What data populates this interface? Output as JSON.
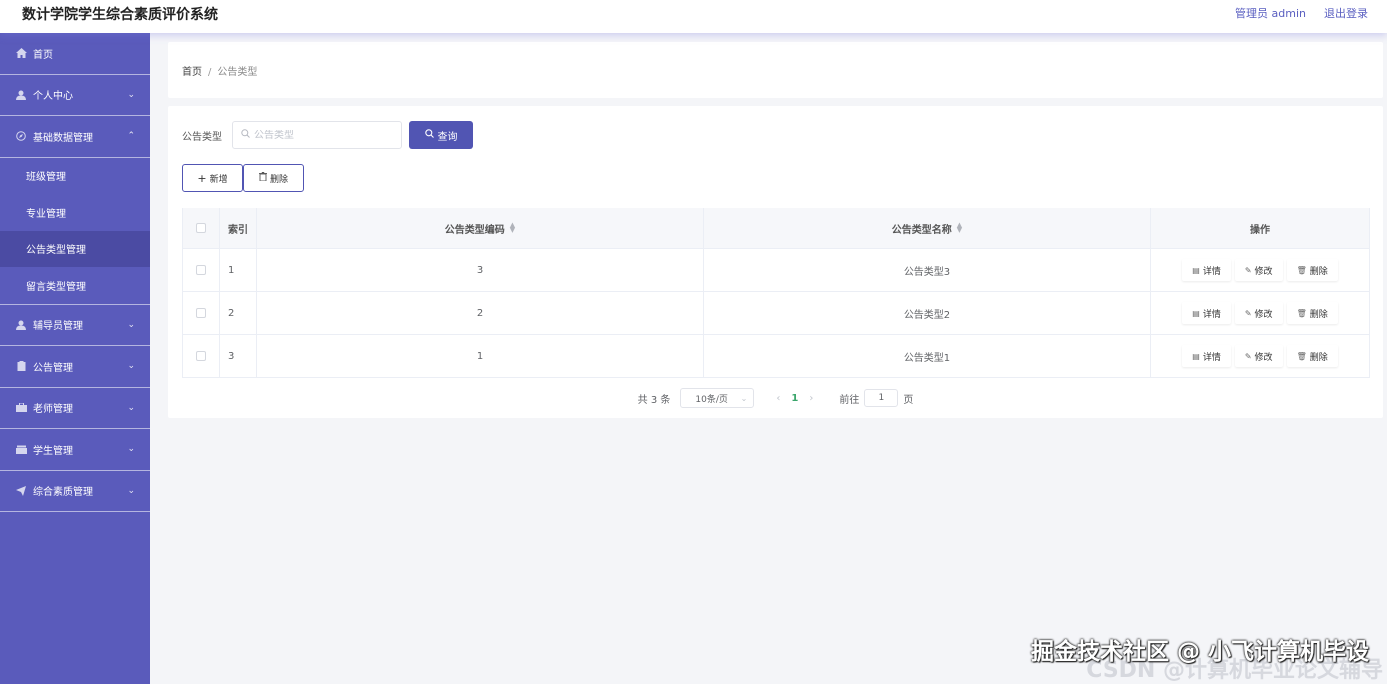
{
  "header": {
    "title": "数计学院学生综合素质评价系统",
    "user_label": "管理员 admin",
    "logout_label": "退出登录"
  },
  "sidebar": {
    "items": [
      {
        "label": "首页",
        "icon": "home-icon"
      },
      {
        "label": "个人中心",
        "icon": "user-icon"
      },
      {
        "label": "基础数据管理",
        "icon": "compass-icon"
      },
      {
        "label": "辅导员管理",
        "icon": "user-icon"
      },
      {
        "label": "公告管理",
        "icon": "clipboard-icon"
      },
      {
        "label": "老师管理",
        "icon": "briefcase-icon"
      },
      {
        "label": "学生管理",
        "icon": "box-icon"
      },
      {
        "label": "综合素质管理",
        "icon": "send-icon"
      }
    ],
    "sub_items": [
      {
        "label": "班级管理"
      },
      {
        "label": "专业管理"
      },
      {
        "label": "公告类型管理"
      },
      {
        "label": "留言类型管理"
      }
    ]
  },
  "breadcrumb": {
    "home": "首页",
    "separator": "/",
    "current": "公告类型"
  },
  "search": {
    "label": "公告类型",
    "placeholder": "公告类型",
    "button_label": "查询"
  },
  "actions": {
    "add_label": "新增",
    "delete_label": "删除"
  },
  "table": {
    "headers": {
      "index": "索引",
      "code": "公告类型编码",
      "name": "公告类型名称",
      "operations": "操作"
    },
    "rows": [
      {
        "index": "1",
        "code": "3",
        "name": "公告类型3"
      },
      {
        "index": "2",
        "code": "2",
        "name": "公告类型2"
      },
      {
        "index": "3",
        "code": "1",
        "name": "公告类型1"
      }
    ],
    "op_labels": {
      "detail": "详情",
      "edit": "修改",
      "delete": "删除"
    }
  },
  "pagination": {
    "total_text": "共 3 条",
    "page_size": "10条/页",
    "current_page": "1",
    "goto_prefix": "前往",
    "goto_value": "1",
    "goto_suffix": "页"
  },
  "watermark": {
    "text": "掘金技术社区 @ 小飞计算机毕设",
    "text2": "CSDN @计算机毕业论文辅导"
  },
  "colors": {
    "sidebar_bg": "#5a5bbb",
    "sidebar_active": "#4b4ba3",
    "primary_button": "#5155b3",
    "header_link": "#5a5fc1",
    "pager_active": "#3aa56b"
  }
}
